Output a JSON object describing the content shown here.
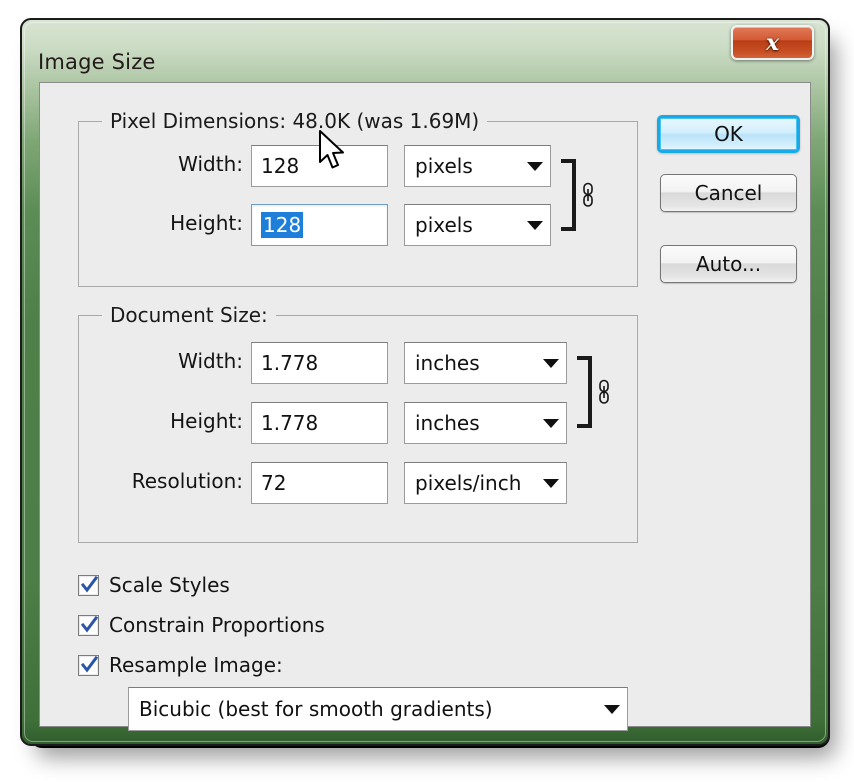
{
  "window": {
    "title": "Image Size",
    "close_label": "x",
    "accent_green": "#4d7e47",
    "panel_bg": "#ececec",
    "selection_blue": "#1d7fd9",
    "default_button_border": "#1aa9e8",
    "close_button_red": "#c74e22"
  },
  "pixel_dimensions": {
    "group_title": "Pixel Dimensions:  48.0K (was 1.69M)",
    "size_current": "48.0K",
    "size_was": "1.69M",
    "width_label": "Width:",
    "width_value": "128",
    "width_unit": "pixels",
    "height_label": "Height:",
    "height_value": "128",
    "height_unit": "pixels",
    "link_icon": "chain-link-icon"
  },
  "document_size": {
    "group_title": "Document Size:",
    "width_label": "Width:",
    "width_value": "1.778",
    "width_unit": "inches",
    "height_label": "Height:",
    "height_value": "1.778",
    "height_unit": "inches",
    "resolution_label": "Resolution:",
    "resolution_value": "72",
    "resolution_unit": "pixels/inch",
    "link_icon": "chain-link-icon"
  },
  "options": {
    "scale_styles": "Scale Styles",
    "scale_styles_checked": true,
    "constrain_proportions": "Constrain Proportions",
    "constrain_proportions_checked": true,
    "resample_image": "Resample Image:",
    "resample_image_checked": true,
    "resample_method": "Bicubic (best for smooth gradients)"
  },
  "buttons": {
    "ok": "OK",
    "cancel": "Cancel",
    "auto": "Auto..."
  }
}
